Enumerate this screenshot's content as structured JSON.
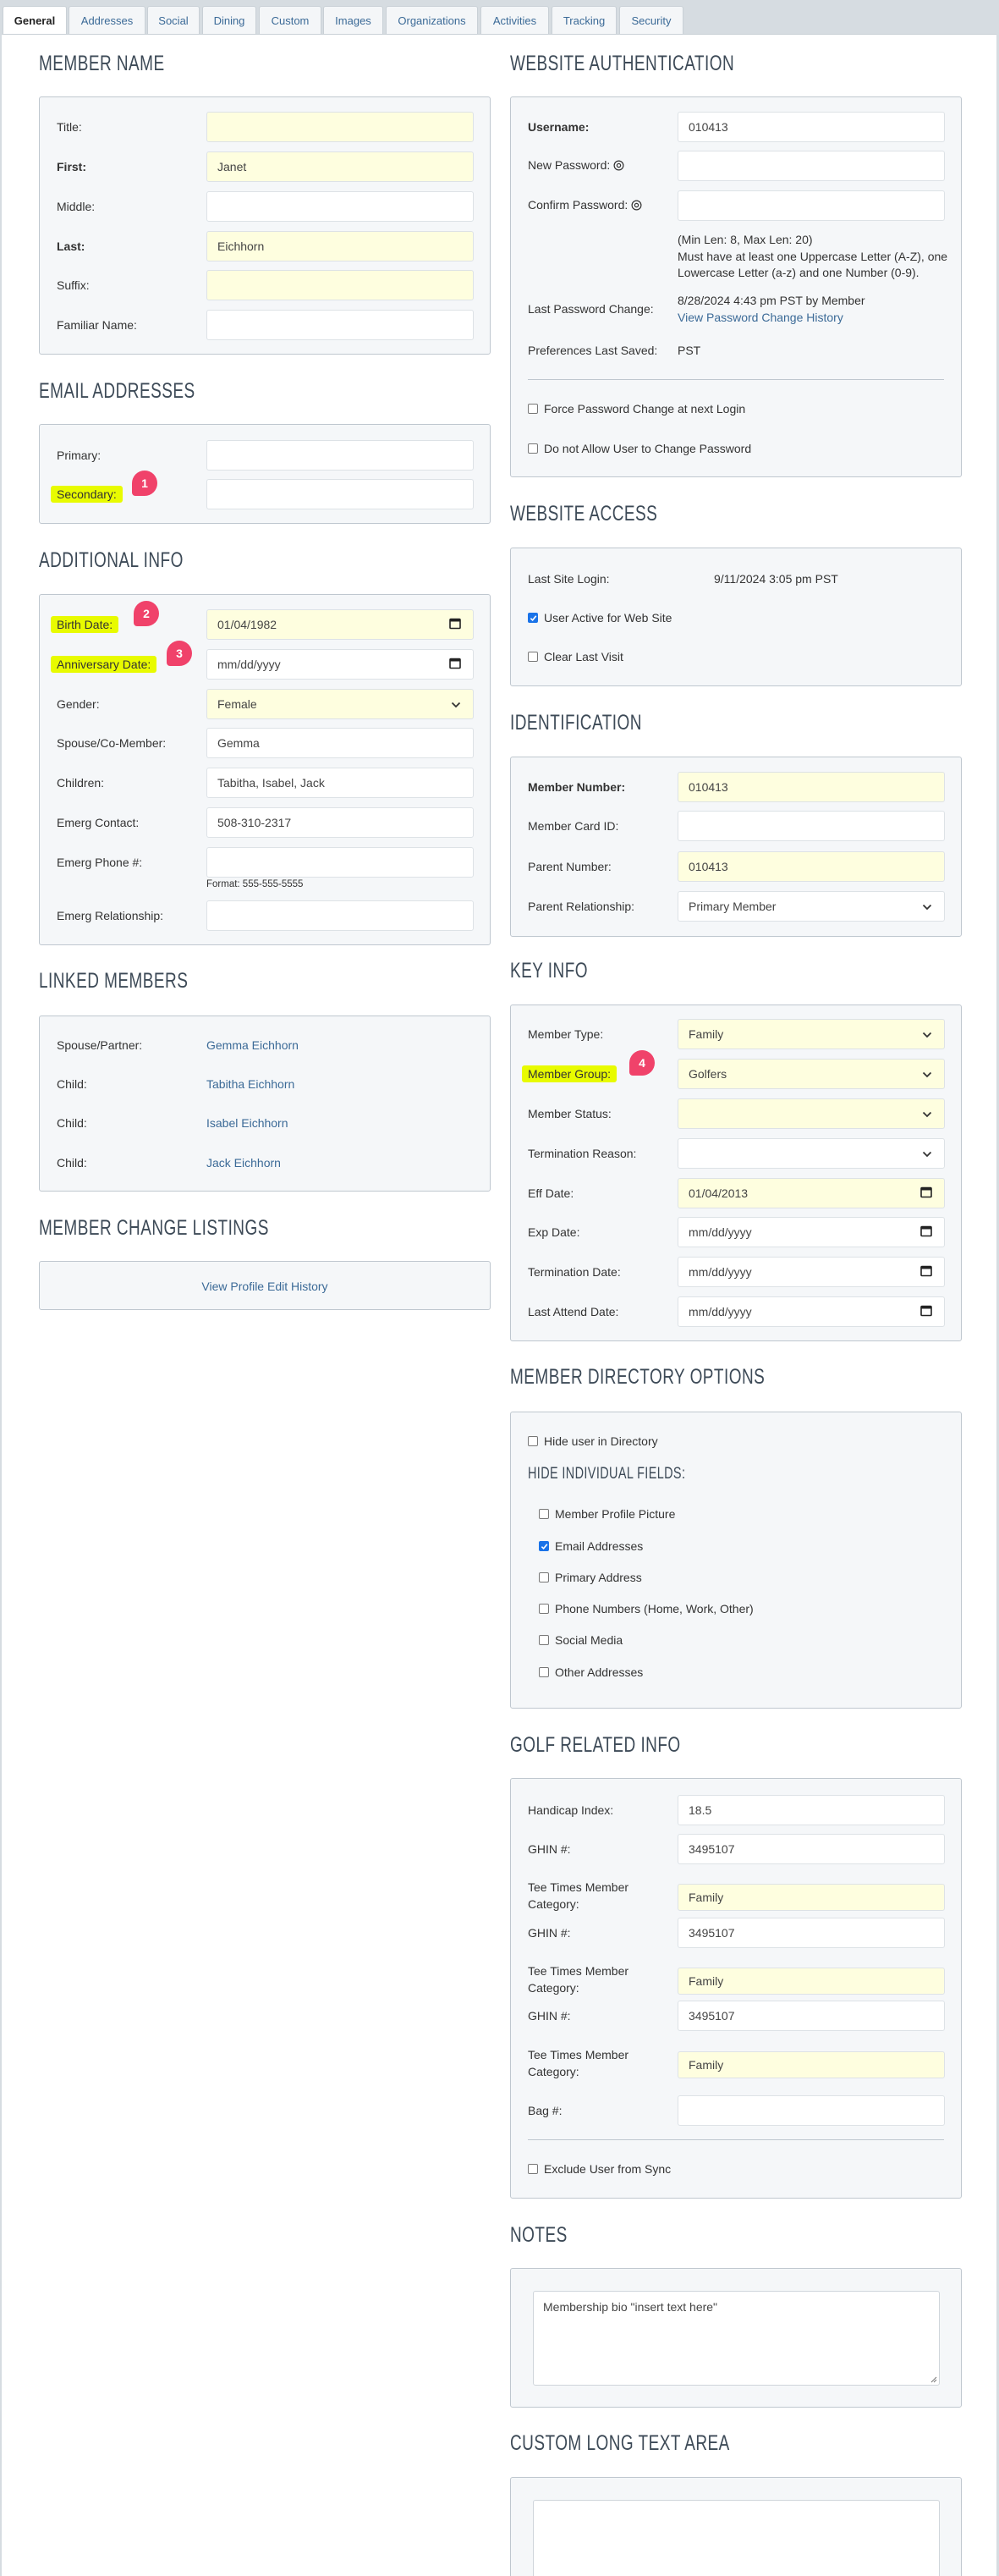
{
  "tabs": {
    "items": [
      "General",
      "Addresses",
      "Social",
      "Dining",
      "Custom",
      "Images",
      "Organizations",
      "Activities",
      "Tracking",
      "Security"
    ],
    "active": "General"
  },
  "colors": {
    "highlight_field": "#fefedf",
    "annotation_highlight": "#e8fb00",
    "annotation_badge": "#f0426a",
    "link": "#3b6a97",
    "checkbox_checked": "#1a73e8"
  },
  "sections": {
    "member_name": {
      "title": "MEMBER NAME",
      "rows": [
        {
          "kind": "text",
          "label": "Title:",
          "value": "",
          "highlighted": true
        },
        {
          "kind": "text",
          "label": "First:",
          "value": "Janet",
          "highlighted": true,
          "bold": true
        },
        {
          "kind": "text",
          "label": "Middle:",
          "value": ""
        },
        {
          "kind": "text",
          "label": "Last:",
          "value": "Eichhorn",
          "highlighted": true,
          "bold": true
        },
        {
          "kind": "text",
          "label": "Suffix:",
          "value": "",
          "highlighted": true
        },
        {
          "kind": "text",
          "label": "Familiar Name:",
          "value": ""
        }
      ]
    },
    "email": {
      "title": "EMAIL ADDRESSES",
      "rows": [
        {
          "kind": "text",
          "label": "Primary:",
          "value": ""
        },
        {
          "kind": "text",
          "label": "Secondary:",
          "value": "",
          "annotation": "1"
        }
      ]
    },
    "additional": {
      "title": "ADDITIONAL INFO",
      "rows": [
        {
          "kind": "date",
          "label": "Birth Date:",
          "value": "01/04/1982",
          "highlighted": true,
          "annotation": "2"
        },
        {
          "kind": "date",
          "label": "Anniversary Date:",
          "value": "",
          "placeholder": "mm/dd/yyyy",
          "annotation": "3"
        },
        {
          "kind": "select",
          "label": "Gender:",
          "value": "Female",
          "highlighted": true
        },
        {
          "kind": "text",
          "label": "Spouse/Co-Member:",
          "value": "Gemma"
        },
        {
          "kind": "text",
          "label": "Children:",
          "value": "Tabitha, Isabel, Jack"
        },
        {
          "kind": "text",
          "label": "Emerg Contact:",
          "value": "508-310-2317"
        },
        {
          "kind": "text",
          "label": "Emerg Phone #:",
          "value": "",
          "hint": "Format: 555-555-5555"
        },
        {
          "kind": "text",
          "label": "Emerg Relationship:",
          "value": ""
        }
      ]
    },
    "linked": {
      "title": "LINKED MEMBERS",
      "rows": [
        {
          "kind": "link",
          "label": "Spouse/Partner:",
          "value": "Gemma Eichhorn"
        },
        {
          "kind": "link",
          "label": "Child:",
          "value": "Tabitha Eichhorn"
        },
        {
          "kind": "link",
          "label": "Child:",
          "value": "Isabel Eichhorn"
        },
        {
          "kind": "link",
          "label": "Child:",
          "value": "Jack Eichhorn"
        }
      ]
    },
    "changes": {
      "title": "MEMBER CHANGE LISTINGS",
      "rows": [
        {
          "kind": "centerlink",
          "value": "View Profile Edit History"
        }
      ]
    },
    "auth": {
      "title": "WEBSITE AUTHENTICATION",
      "rows": [
        {
          "kind": "text",
          "label": "Username:",
          "value": "010413",
          "bold": true
        },
        {
          "kind": "text",
          "label": "New Password:",
          "value": "",
          "eye": true
        },
        {
          "kind": "text",
          "label": "Confirm Password:",
          "value": "",
          "eye": true
        },
        {
          "kind": "help",
          "lines": [
            "(Min Len: 8, Max Len: 20)",
            "Must have at least one Uppercase Letter (A-Z), one",
            "Lowercase Letter (a-z) and one Number (0-9)."
          ]
        },
        {
          "kind": "twoline",
          "label": "Last Password Change:",
          "value": "8/28/2024 4:43 pm PST by Member",
          "link": "View Password Change History"
        },
        {
          "kind": "static",
          "label": "Preferences Last Saved:",
          "value": "PST"
        },
        {
          "kind": "divider"
        },
        {
          "kind": "checkbox",
          "value": "Force Password Change at next Login",
          "checked": false
        },
        {
          "kind": "checkbox",
          "value": "Do not Allow User to Change Password",
          "checked": false
        }
      ]
    },
    "access": {
      "title": "WEBSITE ACCESS",
      "rows": [
        {
          "kind": "static",
          "label": "Last Site Login:",
          "value": "9/11/2024 3:05 pm PST",
          "wide": true
        },
        {
          "kind": "checkbox",
          "value": "User Active for Web Site",
          "checked": true
        },
        {
          "kind": "checkbox",
          "value": "Clear Last Visit",
          "checked": false
        }
      ]
    },
    "ident": {
      "title": "IDENTIFICATION",
      "rows": [
        {
          "kind": "text",
          "label": "Member Number:",
          "value": "010413",
          "highlighted": true,
          "bold": true
        },
        {
          "kind": "text",
          "label": "Member Card ID:",
          "value": ""
        },
        {
          "kind": "text",
          "label": "Parent Number:",
          "value": "010413",
          "highlighted": true
        },
        {
          "kind": "select",
          "label": "Parent Relationship:",
          "value": "Primary Member"
        }
      ]
    },
    "key": {
      "title": "KEY INFO",
      "rows": [
        {
          "kind": "select",
          "label": "Member Type:",
          "value": "Family",
          "highlighted": true
        },
        {
          "kind": "select",
          "label": "Member Group:",
          "value": "Golfers",
          "highlighted": true,
          "annotation": "4"
        },
        {
          "kind": "select",
          "label": "Member Status:",
          "value": "",
          "highlighted": true
        },
        {
          "kind": "select",
          "label": "Termination Reason:",
          "value": ""
        },
        {
          "kind": "date",
          "label": "Eff Date:",
          "value": "01/04/2013",
          "highlighted": true
        },
        {
          "kind": "date",
          "label": "Exp Date:",
          "value": "",
          "placeholder": "mm/dd/yyyy"
        },
        {
          "kind": "date",
          "label": "Termination Date:",
          "value": "",
          "placeholder": "mm/dd/yyyy"
        },
        {
          "kind": "date",
          "label": "Last Attend Date:",
          "value": "",
          "placeholder": "mm/dd/yyyy"
        }
      ]
    },
    "dir": {
      "title": "MEMBER DIRECTORY OPTIONS",
      "rows": [
        {
          "kind": "checkbox",
          "value": "Hide user in Directory",
          "checked": false
        },
        {
          "kind": "subheading",
          "value": "HIDE INDIVIDUAL FIELDS:"
        },
        {
          "kind": "checkbox",
          "value": "Member Profile Picture",
          "checked": false,
          "indent": true
        },
        {
          "kind": "checkbox",
          "value": "Email Addresses",
          "checked": true,
          "indent": true
        },
        {
          "kind": "checkbox",
          "value": "Primary Address",
          "checked": false,
          "indent": true
        },
        {
          "kind": "checkbox",
          "value": "Phone Numbers (Home, Work, Other)",
          "checked": false,
          "indent": true
        },
        {
          "kind": "checkbox",
          "value": "Social Media",
          "checked": false,
          "indent": true
        },
        {
          "kind": "checkbox",
          "value": "Other Addresses",
          "checked": false,
          "indent": true
        }
      ]
    },
    "golf": {
      "title": "GOLF RELATED INFO",
      "rows": [
        {
          "kind": "text",
          "label": "Handicap Index:",
          "value": "18.5"
        },
        {
          "kind": "text",
          "label": "GHIN #:",
          "value": "3495107"
        },
        {
          "kind": "text",
          "label": "Tee Times Member Category:",
          "value": "Family",
          "highlighted": true,
          "two": true
        },
        {
          "kind": "text",
          "label": "GHIN #:",
          "value": "3495107"
        },
        {
          "kind": "text",
          "label": "Tee Times Member Category:",
          "value": "Family",
          "highlighted": true,
          "two": true
        },
        {
          "kind": "text",
          "label": "GHIN #:",
          "value": "3495107"
        },
        {
          "kind": "text",
          "label": "Tee Times Member Category:",
          "value": "Family",
          "highlighted": true,
          "two": true
        },
        {
          "kind": "text",
          "label": "Bag #:",
          "value": ""
        },
        {
          "kind": "divider"
        },
        {
          "kind": "checkbox",
          "value": "Exclude User from Sync",
          "checked": false
        }
      ]
    },
    "notes": {
      "title": "NOTES",
      "rows": [
        {
          "kind": "textarea",
          "value": "Membership bio \"insert text here\""
        }
      ]
    },
    "custom": {
      "title": "CUSTOM LONG TEXT AREA",
      "rows": [
        {
          "kind": "textarea",
          "value": ""
        }
      ]
    }
  }
}
